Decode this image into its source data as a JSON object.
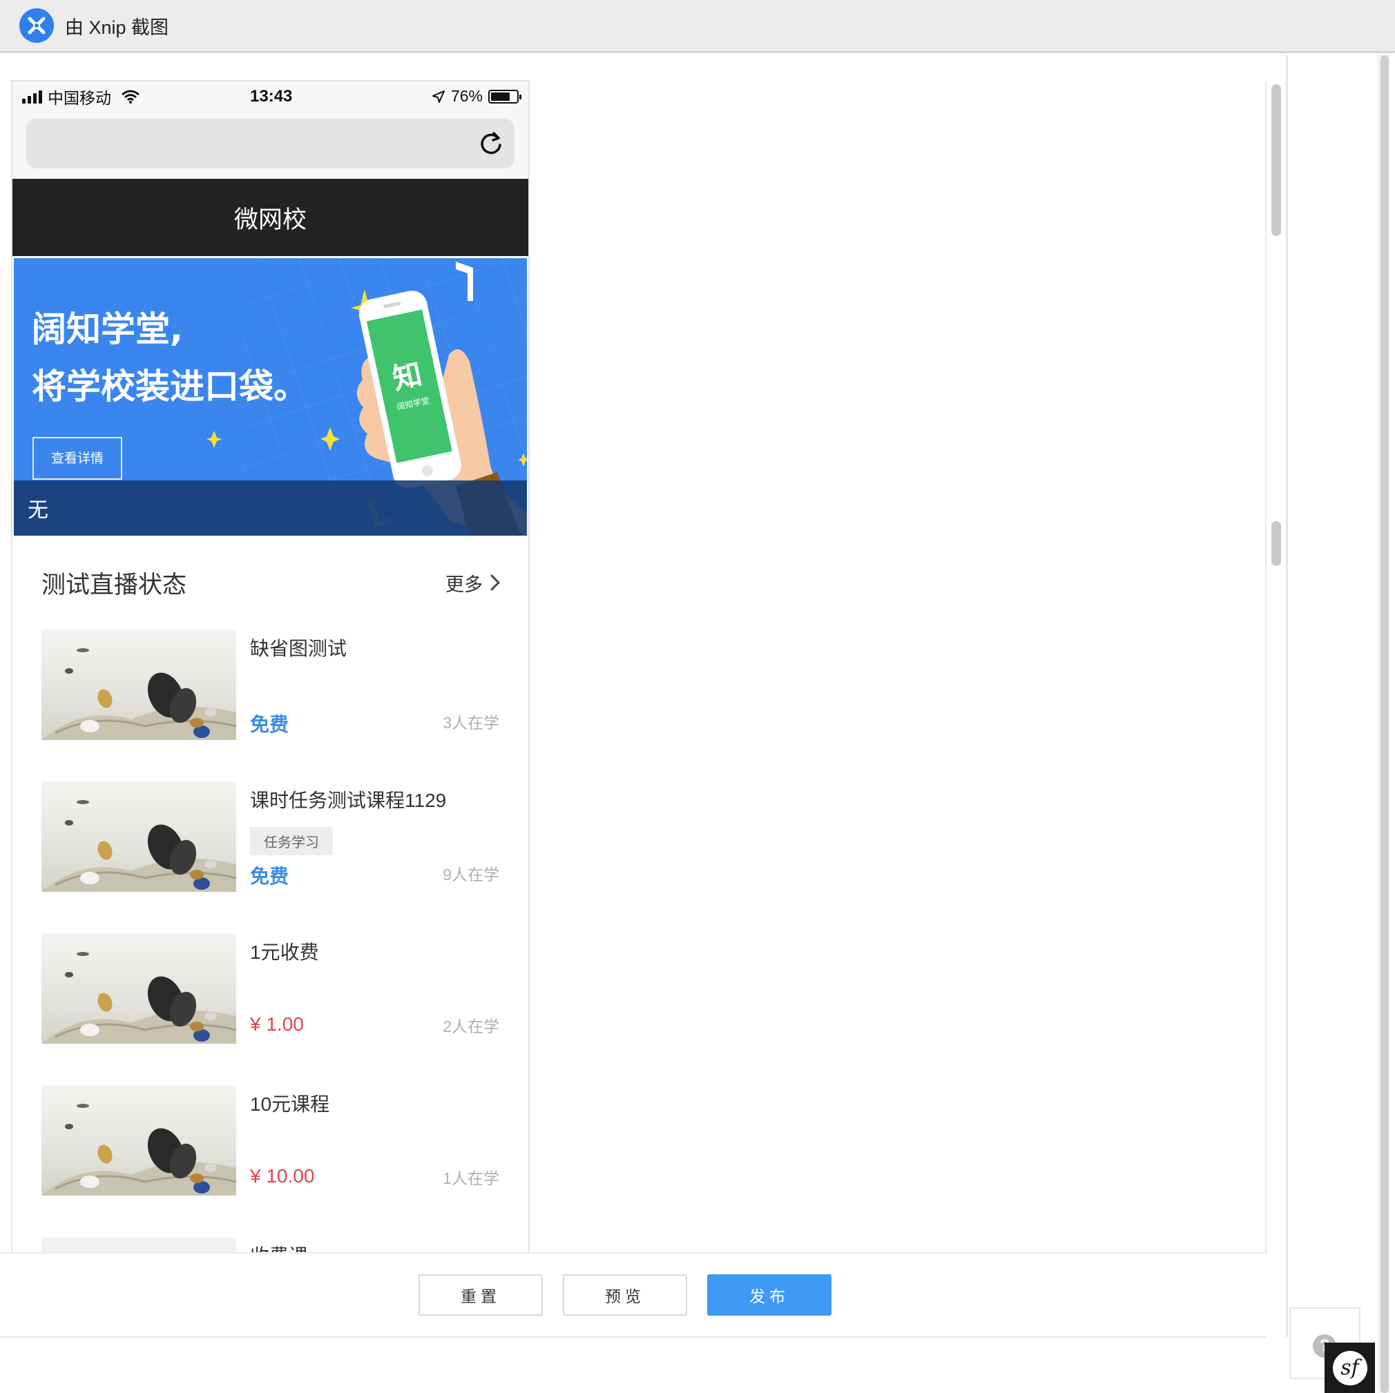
{
  "window": {
    "title": "由 Xnip 截图"
  },
  "status_bar": {
    "carrier": "中国移动",
    "time": "13:43",
    "battery": "76%"
  },
  "app_header": {
    "title": "微网校"
  },
  "banner": {
    "headline_1": "阔知学堂,",
    "headline_2": "将学校装进口袋。",
    "button": "查看详情",
    "phone_logo": "知",
    "phone_sub": "阔知学堂",
    "caption": "无"
  },
  "section": {
    "title": "测试直播状态",
    "more": "更多"
  },
  "courses": [
    {
      "title": "缺省图测试",
      "tag": "",
      "price": "免费",
      "learners": "3人在学"
    },
    {
      "title": "课时任务测试课程1129",
      "tag": "任务学习",
      "price": "免费",
      "learners": "9人在学"
    },
    {
      "title": "1元收费",
      "tag": "",
      "price": "¥ 1.00",
      "learners": "2人在学"
    },
    {
      "title": "10元课程",
      "tag": "",
      "price": "¥ 10.00",
      "learners": "1人在学"
    },
    {
      "title": "收费课",
      "tag": "",
      "price": "",
      "learners": ""
    }
  ],
  "actions": {
    "reset": "重置",
    "preview": "预览",
    "publish": "发布"
  },
  "colors": {
    "accent": "#3e9af5",
    "free": "#3a8ee6",
    "paid": "#e0444d",
    "header": "#232323",
    "banner": "#3a86ee"
  },
  "icons": [
    "app-logo-icon",
    "signal-icon",
    "wifi-icon",
    "location-icon",
    "battery-icon",
    "reload-icon",
    "chevron-right-icon",
    "help-icon",
    "symfony-icon"
  ]
}
